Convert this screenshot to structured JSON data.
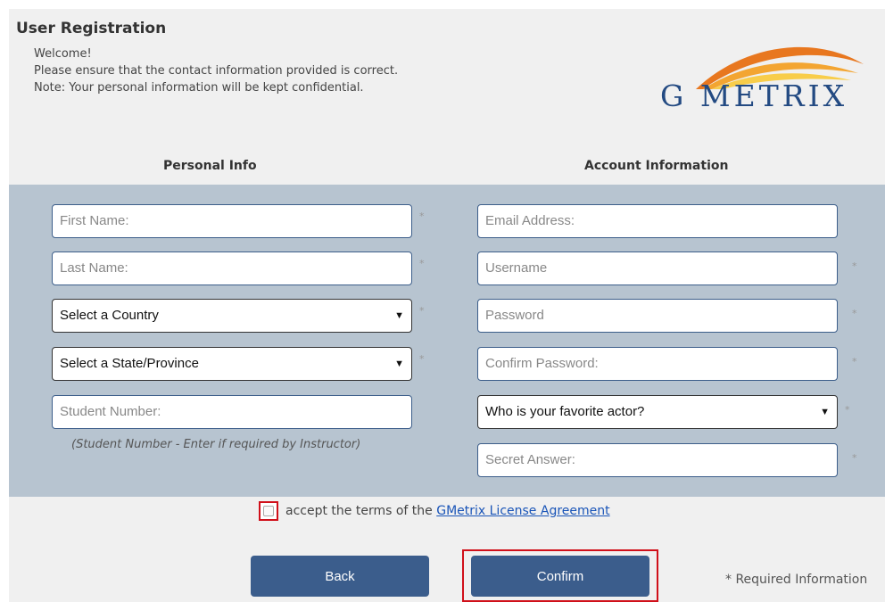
{
  "header": {
    "title": "User Registration",
    "welcome": "Welcome!",
    "line2": "Please ensure that the contact information provided is correct.",
    "line3": "Note: Your personal information will be kept confidential."
  },
  "logo": {
    "text": "G METRIX"
  },
  "personal": {
    "heading": "Personal Info",
    "first_name_placeholder": "First Name:",
    "last_name_placeholder": "Last Name:",
    "country_selected": "Select a Country",
    "state_selected": "Select a State/Province",
    "student_number_placeholder": "Student Number:",
    "student_help": "(Student Number - Enter if required by Instructor)"
  },
  "account": {
    "heading": "Account Information",
    "email_placeholder": "Email Address:",
    "username_placeholder": "Username",
    "password_placeholder": "Password",
    "confirm_password_placeholder": "Confirm Password:",
    "security_question_selected": "Who is your favorite actor?",
    "secret_answer_placeholder": "Secret Answer:"
  },
  "required_mark": "*",
  "terms": {
    "prefix": "accept the terms of the",
    "link": "GMetrix License Agreement"
  },
  "buttons": {
    "back": "Back",
    "confirm": "Confirm"
  },
  "required_note": "* Required Information",
  "colors": {
    "brand_blue": "#234a82",
    "brand_orange": "#e8771f",
    "button": "#3b5d8c",
    "form_bg": "#b7c4d0",
    "highlight": "#d0101a"
  },
  "icons": {
    "dropdown": "chevron-down-icon"
  }
}
